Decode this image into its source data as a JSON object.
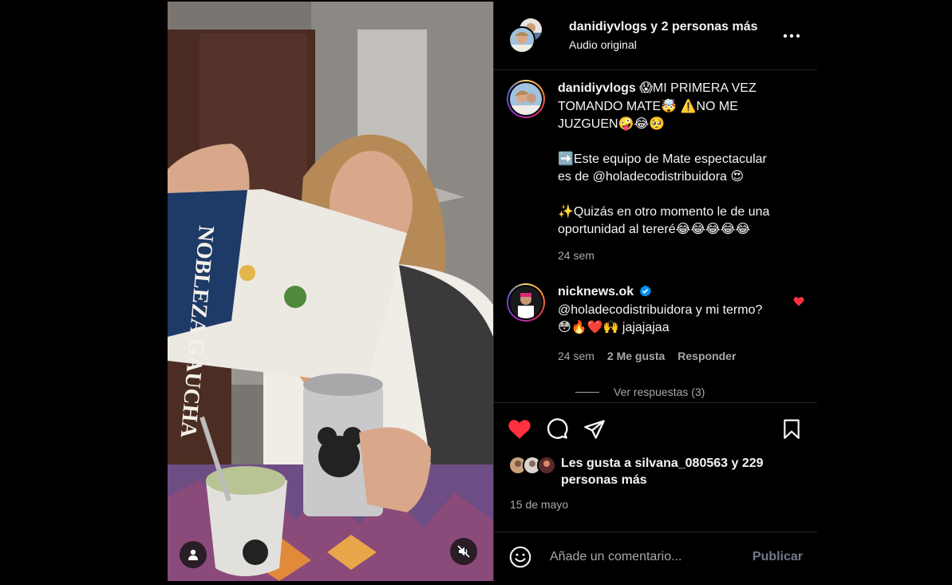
{
  "header": {
    "username": "danidiyvlogs",
    "coauthors": "y 2 personas más",
    "audio": "Audio original"
  },
  "caption": {
    "username": "danidiyvlogs",
    "lines": [
      "😱MI PRIMERA VEZ",
      "TOMANDO MATE🤯 ⚠️NO ME",
      "JUZGUEN🤪😂🥺",
      "",
      "➡️Este equipo de Mate espectacular",
      "es de @holadecodistribuidora 😍",
      "",
      "✨Quizás en otro momento le de una",
      "oportunidad al tereré😂😂😂😂😂"
    ],
    "time": "24 sem"
  },
  "comment": {
    "username": "nicknews.ok",
    "lines": [
      "@holadecodistribuidora y mi termo?",
      "😳🔥❤️🙌 jajajajaa"
    ],
    "time": "24 sem",
    "likes": "2 Me gusta",
    "reply_label": "Responder",
    "view_replies": "Ver respuestas (3)"
  },
  "likes": {
    "prefix": "Les gusta a",
    "user": "silvana_080563",
    "suffix": "y 229 personas más"
  },
  "date": "15 de mayo",
  "composer": {
    "placeholder": "Añade un comentario...",
    "publish": "Publicar"
  },
  "media": {
    "package_text": "NOBLEZA GAUCHA"
  },
  "colors": {
    "like_red": "#ff3040",
    "verified_blue": "#0095f6",
    "muted_text": "#a8a8a8",
    "border": "#262626"
  }
}
